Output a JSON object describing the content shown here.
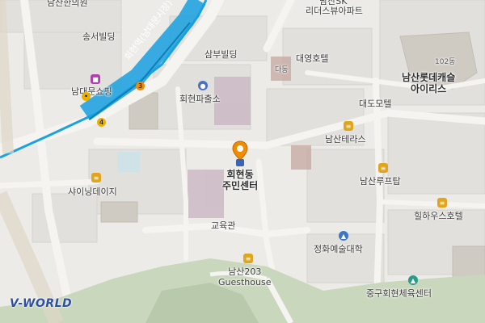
{
  "map": {
    "logo": "V-WORLD",
    "road_label": "회현역(남대문시장)",
    "labels": {
      "namsan_hanuiwon": "남산한의원",
      "namsan_sk": "남산SK",
      "leaders_view": "리더스뷰아파트",
      "songseo_building": "송서빌딩",
      "sambu_building": "삼부빌딩",
      "daeyoung_hotel": "대영호텔",
      "dadong": "다동",
      "lotte_castle_line1": "남산롯데캐슬",
      "lotte_castle_line2": "아이리스",
      "building_code": "102동",
      "namdaemun_mall": "남대문쇼핑",
      "hoehyeon_police": "회현파출소",
      "daedo_motel": "대도모텔",
      "community_center_line1": "회현동",
      "community_center_line2": "주민센터",
      "namsan_terrace": "남산테라스",
      "shining_daisy": "샤이닝데이지",
      "namsan_roof_top": "남산루프탑",
      "hillhouse_hotel": "힐하우스호텔",
      "education_hall": "교육관",
      "junghwa_art": "정화예술대학",
      "namsan203_line1": "남산203",
      "namsan203_line2": "Guesthouse",
      "junggu_gym": "중구회현체육센터"
    },
    "station_exits": [
      "3",
      "4"
    ]
  }
}
